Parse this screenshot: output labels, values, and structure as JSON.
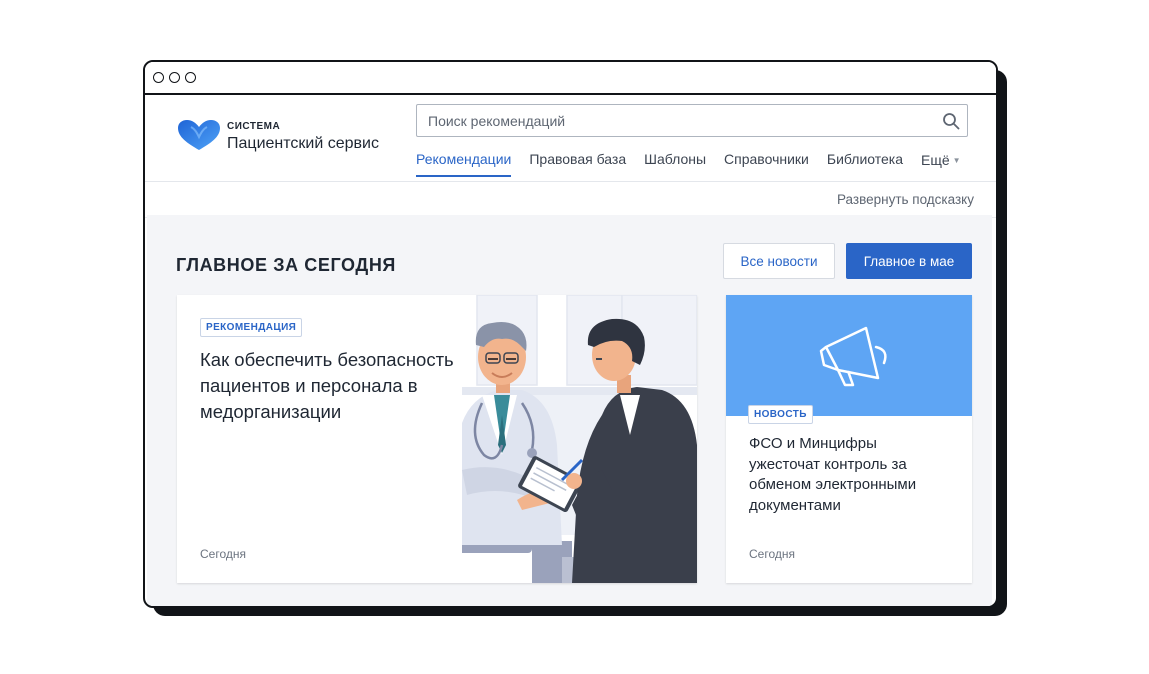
{
  "brand": {
    "top": "СИСТЕМА",
    "name": "Пациентский сервис",
    "color": "#2a65c7"
  },
  "search": {
    "placeholder": "Поиск рекомендаций"
  },
  "nav": {
    "items": [
      {
        "label": "Рекомендации",
        "active": true
      },
      {
        "label": "Правовая база",
        "active": false
      },
      {
        "label": "Шаблоны",
        "active": false
      },
      {
        "label": "Справочники",
        "active": false
      },
      {
        "label": "Библиотека",
        "active": false
      }
    ],
    "more": "Ещё"
  },
  "hint": {
    "label": "Развернуть подсказку"
  },
  "main": {
    "section_title": "ГЛАВНОЕ ЗА СЕГОДНЯ",
    "btn_all_news": "Все новости",
    "btn_main_month": "Главное в мае"
  },
  "cards": [
    {
      "tag": "РЕКОМЕНДАЦИЯ",
      "title": "Как обеспечить безопасность пациентов и персонала в медорганизации",
      "date": "Сегодня"
    },
    {
      "tag": "НОВОСТЬ",
      "title": "ФСО и Минцифры ужесточат контроль за обменом электронными документами",
      "date": "Сегодня",
      "icon": "megaphone-icon"
    }
  ],
  "colors": {
    "accent": "#2a65c7",
    "banner": "#5ea5f4",
    "background": "#f4f5f8"
  }
}
